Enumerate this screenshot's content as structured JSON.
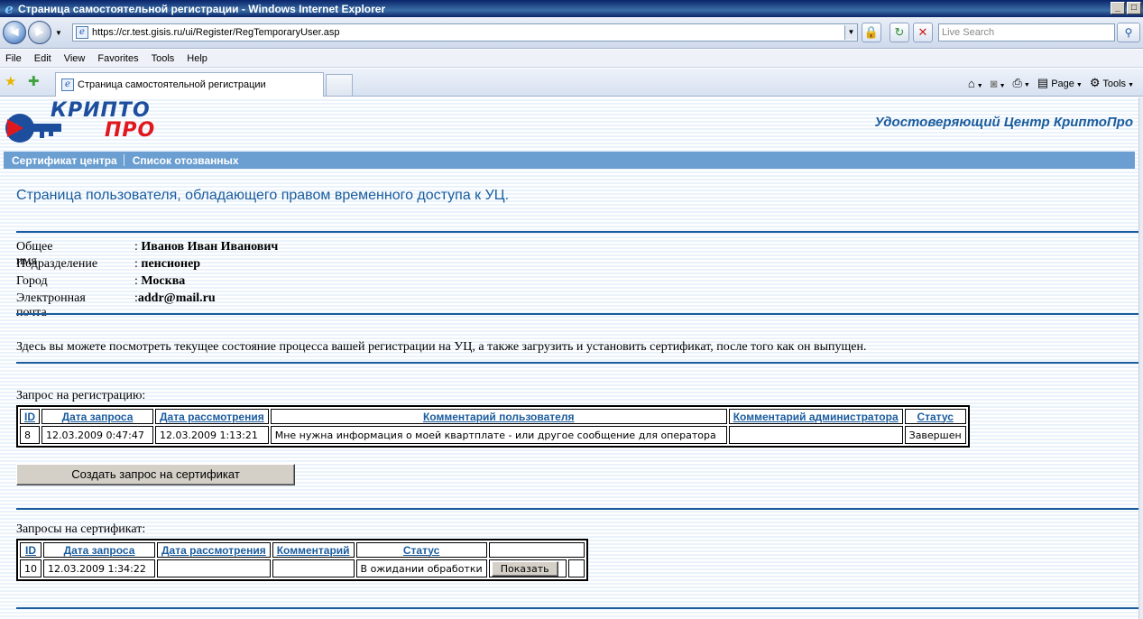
{
  "window": {
    "title": "Страница самостоятельной регистрации - Windows Internet Explorer"
  },
  "toolbar": {
    "url": "https://cr.test.gisis.ru/ui/Register/RegTemporaryUser.asp",
    "search_placeholder": "Live Search"
  },
  "menu": [
    "File",
    "Edit",
    "View",
    "Favorites",
    "Tools",
    "Help"
  ],
  "tab": {
    "title": "Страница самостоятельной регистрации"
  },
  "commandbar": {
    "page": "Page",
    "tools": "Tools"
  },
  "site": {
    "logo_top": "КРИПТО",
    "logo_bottom": "ПРО",
    "header_title": "Удостоверяющий Центр КриптоПро",
    "nav": [
      "Сертификат центра",
      "Список отозванных"
    ]
  },
  "page": {
    "heading": "Страница пользователя, обладающего правом временного доступа к УЦ.",
    "fields": [
      {
        "label": "Общее имя",
        "sep": ": ",
        "value": "Иванов Иван Иванович"
      },
      {
        "label": "Подразделение",
        "sep": ": ",
        "value": "пенсионер"
      },
      {
        "label": "Город",
        "sep": ": ",
        "value": "Москва"
      },
      {
        "label": "Электронная почта",
        "sep": ":",
        "value": "addr@mail.ru"
      }
    ],
    "description": "Здесь вы можете посмотреть текущее состояние процесса вашей регистрации на УЦ, а также загрузить и установить сертификат, после того как он выпущен.",
    "reg_caption": "Запрос на регистрацию:",
    "reg_table": {
      "headers": [
        "ID",
        "Дата запроса",
        "Дата рассмотрения",
        "Комментарий пользователя",
        "Комментарий администратора",
        "Статус"
      ],
      "rows": [
        [
          "8",
          "12.03.2009 0:47:47",
          "12.03.2009 1:13:21",
          "Мне нужна информация о моей квартплате - или другое сообщение для оператора",
          "",
          "Завершен"
        ]
      ]
    },
    "create_button": "Создать запрос на сертификат",
    "cert_caption": "Запросы на сертификат:",
    "cert_table": {
      "headers": [
        "ID",
        "Дата запроса",
        "Дата рассмотрения",
        "Комментарий",
        "Статус",
        ""
      ],
      "rows": [
        [
          "10",
          "12.03.2009 1:34:22",
          "",
          "",
          "В ожидании обработки",
          "Показать"
        ]
      ]
    }
  }
}
